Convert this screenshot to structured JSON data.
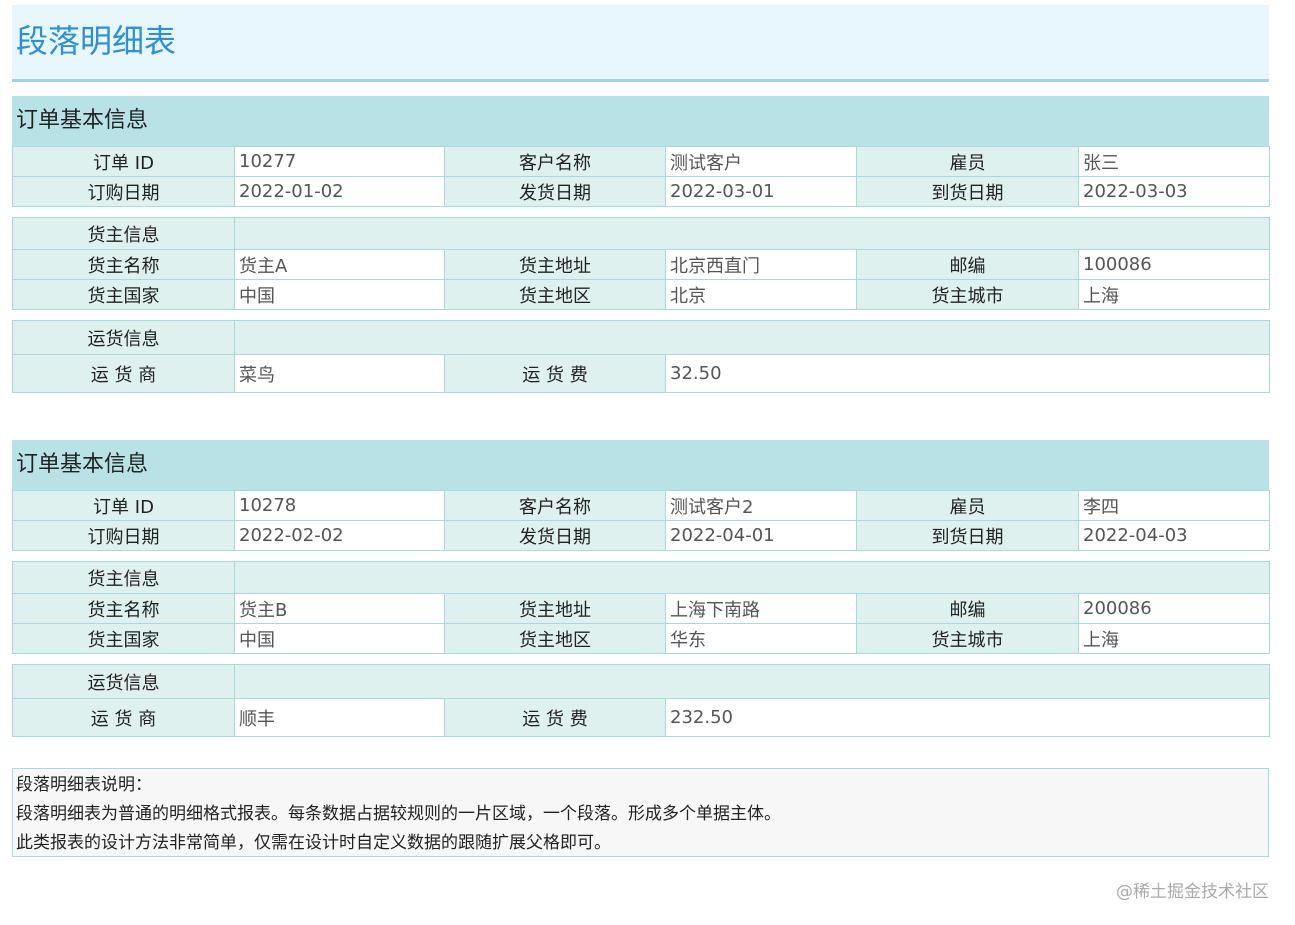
{
  "page": {
    "title": "段落明细表"
  },
  "labels": {
    "section_title": "订单基本信息",
    "order_id": "订单 ID",
    "customer_name": "客户名称",
    "employee": "雇员",
    "order_date": "订购日期",
    "ship_date": "发货日期",
    "arrive_date": "到货日期",
    "shipper_info": "货主信息",
    "shipper_name": "货主名称",
    "shipper_address": "货主地址",
    "postcode": "邮编",
    "shipper_country": "货主国家",
    "shipper_region": "货主地区",
    "shipper_city": "货主城市",
    "freight_info": "运货信息",
    "carrier": "运 货 商",
    "freight": "运 货 费"
  },
  "orders": [
    {
      "order_id": "10277",
      "customer_name": "测试客户",
      "employee": "张三",
      "order_date": "2022-01-02",
      "ship_date": "2022-03-01",
      "arrive_date": "2022-03-03",
      "shipper_name": "货主A",
      "shipper_address": "北京西直门",
      "postcode": "100086",
      "shipper_country": "中国",
      "shipper_region": "北京",
      "shipper_city": "上海",
      "carrier": "菜鸟",
      "freight": "32.50"
    },
    {
      "order_id": "10278",
      "customer_name": "测试客户2",
      "employee": "李四",
      "order_date": "2022-02-02",
      "ship_date": "2022-04-01",
      "arrive_date": "2022-04-03",
      "shipper_name": "货主B",
      "shipper_address": "上海下南路",
      "postcode": "200086",
      "shipper_country": "中国",
      "shipper_region": "华东",
      "shipper_city": "上海",
      "carrier": "顺丰",
      "freight": "232.50"
    }
  ],
  "note": {
    "line1": "段落明细表说明：",
    "line2": "段落明细表为普通的明细格式报表。每条数据占据较规则的一片区域，一个段落。形成多个单据主体。",
    "line3": "此类报表的设计方法非常简单，仅需在设计时自定义数据的跟随扩展父格即可。"
  },
  "watermark": "@稀土掘金技术社区"
}
